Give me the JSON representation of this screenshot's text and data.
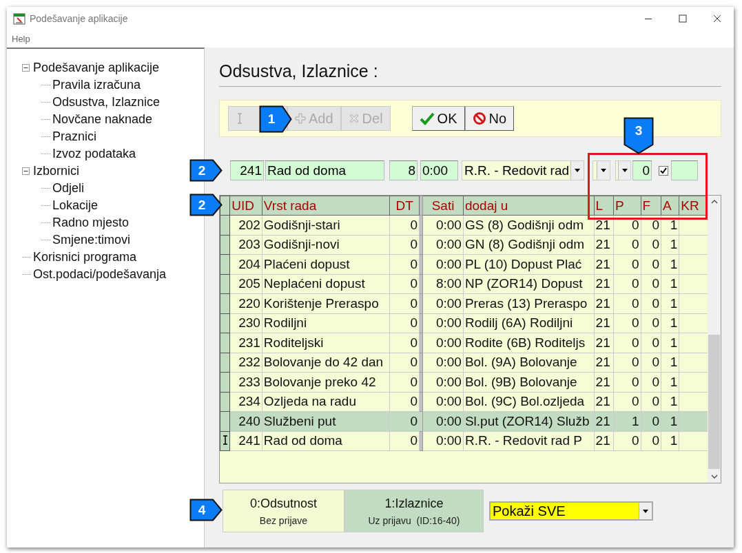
{
  "window": {
    "title": "Podešavanje aplikacije"
  },
  "menu": [
    "Help"
  ],
  "tree": [
    {
      "label": "Podešavanje aplikacije",
      "expanded": true,
      "children": [
        {
          "label": "Pravila izračuna"
        },
        {
          "label": "Odsustva, Izlaznice"
        },
        {
          "label": "Novčane naknade"
        },
        {
          "label": "Praznici"
        },
        {
          "label": "Izvoz podataka"
        }
      ]
    },
    {
      "label": "Izbornici",
      "expanded": true,
      "children": [
        {
          "label": "Odjeli"
        },
        {
          "label": "Lokacije"
        },
        {
          "label": "Radno mjesto"
        },
        {
          "label": "Smjene:timovi"
        }
      ]
    },
    {
      "label": "Korisnici programa"
    },
    {
      "label": "Ost.podaci/podešavanja"
    }
  ],
  "heading": "Odsustva, Izlaznice :",
  "toolbar": [
    {
      "kind": "edit",
      "disabled": true
    },
    {
      "kind": "add",
      "label": "Add",
      "disabled": true
    },
    {
      "kind": "delete",
      "label": "Del",
      "disabled": true
    },
    {
      "kind": "confirm",
      "label": "OK",
      "disabled": false
    },
    {
      "kind": "cancel",
      "label": "No",
      "disabled": false
    }
  ],
  "edit_row": [
    {
      "kind": "field",
      "value": "241"
    },
    {
      "kind": "field",
      "value": "Rad od doma"
    },
    {
      "kind": "field",
      "value": "8"
    },
    {
      "kind": "field",
      "value": "0:00"
    },
    {
      "kind": "combo",
      "value": "R.R. - Redovit rad"
    },
    {
      "kind": "combo"
    },
    {
      "kind": "combo"
    },
    {
      "kind": "field",
      "value": "0"
    },
    {
      "kind": "checkbox",
      "checked": true
    },
    {
      "kind": "field"
    }
  ],
  "table": {
    "columns": [
      "UID",
      "Vrst rada",
      "DT",
      "Sati",
      "dodaj u",
      "L",
      "P",
      "F",
      "A",
      "KR"
    ],
    "rows": [
      {
        "cells": [
          "202",
          "Godišnji-stari",
          "0",
          "0:00",
          "GS (8) Godišnji odm",
          "21",
          "0",
          "0",
          "1"
        ],
        "selected": false,
        "current": false
      },
      {
        "cells": [
          "203",
          "Godišnji-novi",
          "0",
          "0:00",
          "GN (8) Godišnji odm",
          "21",
          "0",
          "0",
          "1"
        ],
        "selected": false,
        "current": false
      },
      {
        "cells": [
          "204",
          "Plaćeni dopust",
          "0",
          "0:00",
          "PL (10) Dopust Plać",
          "21",
          "0",
          "0",
          "1"
        ],
        "selected": false,
        "current": false
      },
      {
        "cells": [
          "205",
          "Neplaćeni dopust",
          "0",
          "8:00",
          "NP (ZOR14)  Dopust",
          "21",
          "0",
          "0",
          "1"
        ],
        "selected": false,
        "current": false
      },
      {
        "cells": [
          "220",
          "Korištenje Preraspo",
          "0",
          "0:00",
          "Preras (13) Preraspo",
          "21",
          "0",
          "0",
          "1"
        ],
        "selected": false,
        "current": false
      },
      {
        "cells": [
          "230",
          "Rodiljni",
          "0",
          "0:00",
          "Rodilj (6A) Rodiljni",
          "21",
          "0",
          "0",
          "1"
        ],
        "selected": false,
        "current": false
      },
      {
        "cells": [
          "231",
          "Roditeljski",
          "0",
          "0:00",
          "Rodite (6B) Roditeljs",
          "21",
          "0",
          "0",
          "1"
        ],
        "selected": false,
        "current": false
      },
      {
        "cells": [
          "232",
          "Bolovanje do 42 dan",
          "0",
          "0:00",
          "Bol. (9A) Bolovanje",
          "21",
          "0",
          "0",
          "1"
        ],
        "selected": false,
        "current": false
      },
      {
        "cells": [
          "233",
          "Bolovanje preko 42",
          "0",
          "0:00",
          "Bol.  (9B) Bolovanje",
          "21",
          "0",
          "0",
          "1"
        ],
        "selected": false,
        "current": false
      },
      {
        "cells": [
          "234",
          "Ozljeda na radu",
          "0",
          "0:00",
          "Bol.  (9C) Bol.ozljeda",
          "21",
          "0",
          "0",
          "1"
        ],
        "selected": false,
        "current": false
      },
      {
        "cells": [
          "240",
          "Službeni put",
          "0",
          "0:00",
          "Sl.put (ZOR14) Služb",
          "21",
          "1",
          "0",
          "1"
        ],
        "selected": true,
        "current": false
      },
      {
        "cells": [
          "241",
          "Rad od doma",
          "0",
          "0:00",
          "R.R. - Redovit rad P",
          "21",
          "0",
          "0",
          "1"
        ],
        "selected": false,
        "current": true
      }
    ]
  },
  "tabs": [
    {
      "title": "0:Odsutnost",
      "subtitle": "Bez prijave",
      "selected": true
    },
    {
      "title": "1:Izlaznice",
      "subtitle": "Uz prijavu  (ID:16-40)",
      "selected": false
    }
  ],
  "filter": {
    "value": "Pokaži SVE"
  },
  "callouts": [
    {
      "number": "1"
    },
    {
      "number": "2"
    },
    {
      "number": "2"
    },
    {
      "number": "3"
    },
    {
      "number": "4"
    }
  ]
}
